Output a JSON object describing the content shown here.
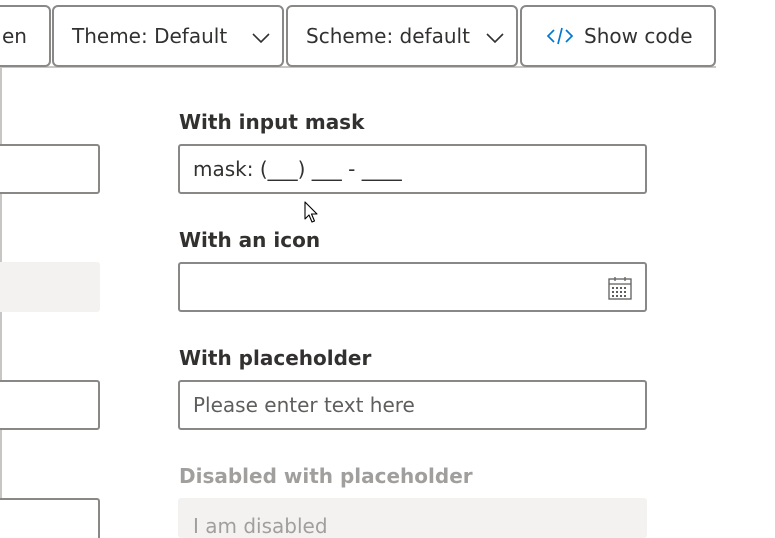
{
  "toolbar": {
    "partial_label": "en",
    "theme_label": "Theme: Default",
    "scheme_label": "Scheme: default",
    "code_icon": "code-icon",
    "code_label": "Show code"
  },
  "fields": {
    "mask": {
      "label": "With input mask",
      "value": "mask: (___) ___ - ____"
    },
    "icon": {
      "label": "With an icon",
      "value": "",
      "icon": "calendar-icon"
    },
    "placeholder": {
      "label": "With placeholder",
      "placeholder": "Please enter text here"
    },
    "disabled_placeholder": {
      "label": "Disabled with placeholder",
      "placeholder": "I am disabled"
    }
  },
  "colors": {
    "accent": "#0078d4",
    "border": "#8a8886",
    "disabled_bg": "#f3f2f1",
    "disabled_text": "#a19f9d",
    "text": "#323130"
  }
}
